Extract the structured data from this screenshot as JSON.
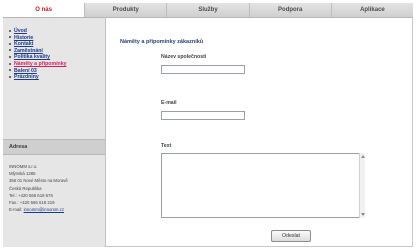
{
  "topnav": {
    "tabs": [
      {
        "label": "O nás",
        "active": true
      },
      {
        "label": "Produkty",
        "active": false
      },
      {
        "label": "Služby",
        "active": false
      },
      {
        "label": "Podpora",
        "active": false
      },
      {
        "label": "Aplikace",
        "active": false
      }
    ]
  },
  "sidebar": {
    "items": [
      {
        "label": "Úvod"
      },
      {
        "label": "Historie"
      },
      {
        "label": "Kontakt"
      },
      {
        "label": "Zaměstnání"
      },
      {
        "label": "Politika kvality"
      },
      {
        "label": "Náměty a připomínky",
        "current": true
      },
      {
        "label": "Balení 03"
      },
      {
        "label": "Prázdniny"
      }
    ],
    "address_heading": "Adresa",
    "address_lines": [
      "INNOMM s.r.o.",
      "Mlýnská 1285",
      "356 01 Nové Město na Moravě",
      "Česká Republika",
      "Tel.: +420 566 618 676",
      "Fax.: +420 566 618 219"
    ],
    "email_label": "E-mail:",
    "email": "innomm@innomm.cz"
  },
  "form": {
    "title": "Náměty a připomínky zákazníků",
    "company_label": "Název společnosti",
    "company_value": "",
    "email_label": "E-mail",
    "email_value": "",
    "text_label": "Text",
    "text_value": "",
    "submit_label": "Odeslat"
  }
}
